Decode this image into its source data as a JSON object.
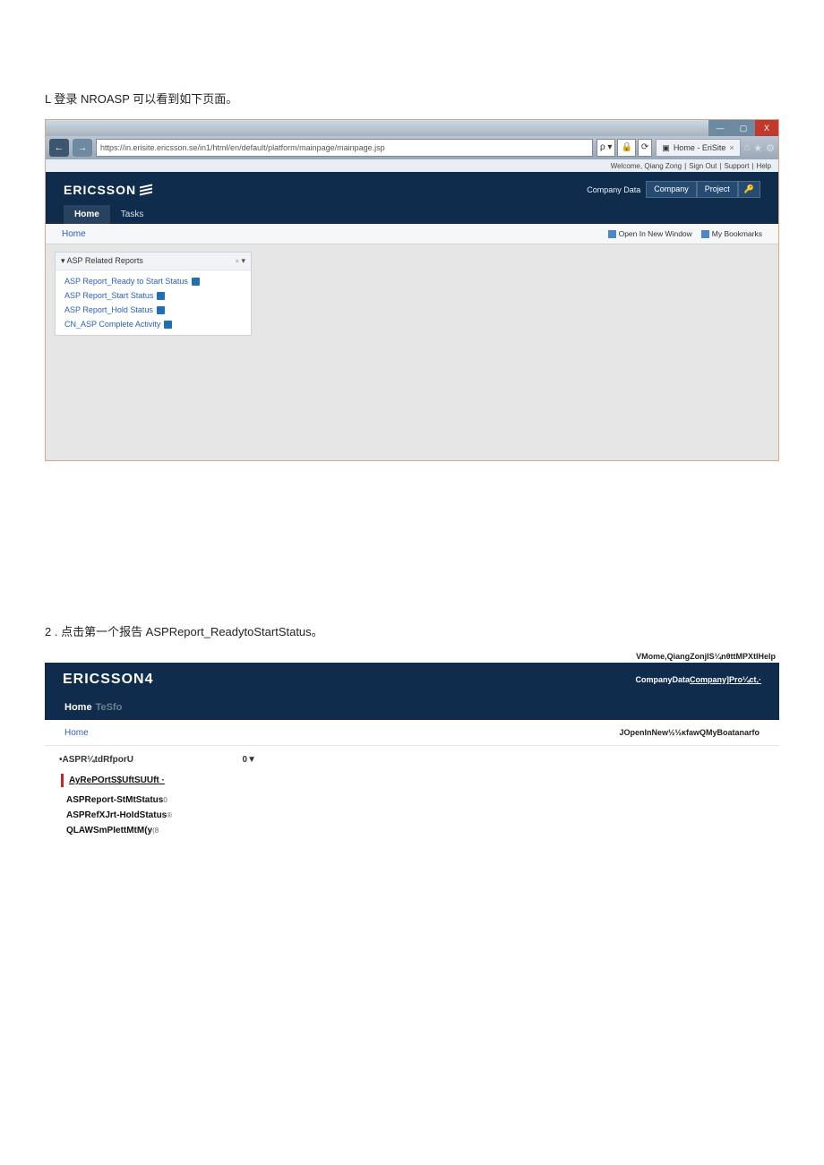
{
  "doc": {
    "step1_text": "L 登录 NROASP 可以看到如下页面。",
    "step2_text": "2   . 点击第一个报告 ASPReport_ReadytoStartStatus。"
  },
  "shot1": {
    "win": {
      "min": "—",
      "max": "▢",
      "close": "X"
    },
    "nav": {
      "back": "←",
      "fwd": "→"
    },
    "url": "https://in.erisite.ericsson.se/in1/html/en/default/platform/mainpage/mainpage.jsp",
    "search_icons": {
      "mag": "ρ ▾",
      "lock": "🔒",
      "refresh": "⟳"
    },
    "tab": {
      "icon": "▣",
      "title": "Home - EriSite",
      "close": "×"
    },
    "corner": {
      "home": "⌂",
      "star": "★",
      "gear": "⚙"
    },
    "welcome": {
      "w": "Welcome, Qiang Zong",
      "s": "Sign Out",
      "sp": "Support",
      "h": "Help"
    },
    "logo": "ERICSSON",
    "cbar": {
      "label": "Company Data",
      "b1": "Company",
      "b2": "Project",
      "b3": "🔑"
    },
    "tabs": {
      "home": "Home",
      "tasks": "Tasks"
    },
    "crumb": "Home",
    "right": {
      "open": "Open In New Window",
      "bm": "My Bookmarks"
    },
    "panel": {
      "title": "ASP Related Reports",
      "ic1": "▫",
      "ic2": "▾",
      "items": [
        "ASP Report_Ready to Start Status",
        "ASP Report_Start Status",
        "ASP Report_Hold Status",
        "CN_ASP Complete Activity"
      ]
    }
  },
  "shot2": {
    "topright": "VMome,QiangZonjIS¼nθttMPXtIHelp",
    "logo": "ERICSSON4",
    "cbar": "CompanyDataCompany]Pro¼ct,·",
    "tabs": {
      "home": "Home",
      "tasks": "TeSfo"
    },
    "crumb": "Home",
    "right": "JOpenInNew½½κfawQMyBoatanarfo",
    "panel_title": "•ASPR¼tdRfporU",
    "panel_r": "0▼",
    "selected": "AyRePOrtS$UftSUUft",
    "sel_marker": "·",
    "items": [
      {
        "t": "ASPReport-StMtStatus",
        "s": "0"
      },
      {
        "t": "ASPRefXJrt-HoIdStatus",
        "s": "®"
      },
      {
        "t": "QLAWSmPIettMtM(y",
        "s": "(8"
      }
    ]
  }
}
